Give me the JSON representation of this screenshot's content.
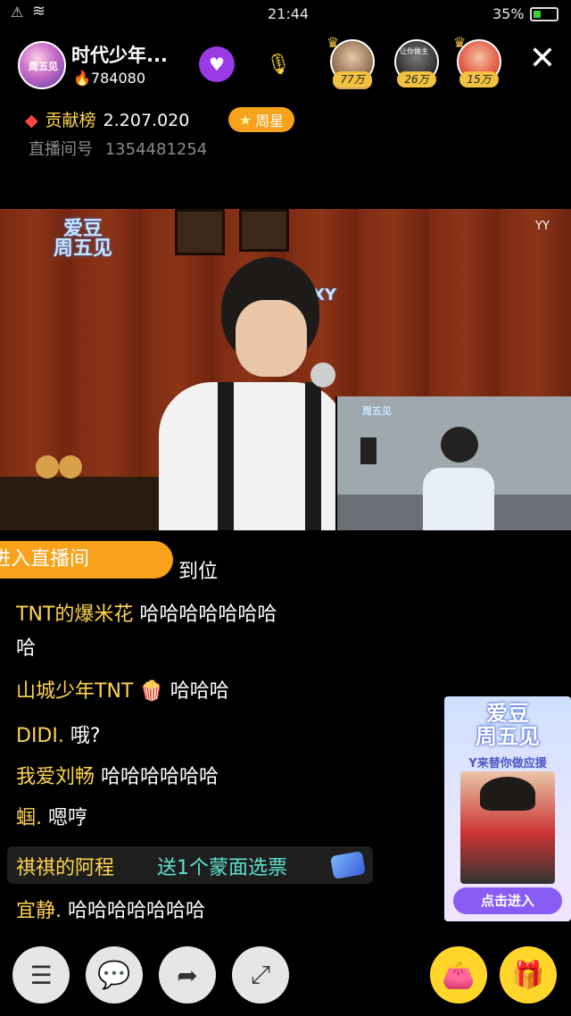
{
  "status_bar": {
    "time": "21:44",
    "battery_percent": "35%",
    "battery_level": 0.35,
    "icons": [
      "alert-icon",
      "wifi-icon",
      "battery-icon"
    ]
  },
  "header": {
    "anchor_name": "时代少年...",
    "fans_count": "784080",
    "avatar_text": "周五见",
    "rank": [
      {
        "label": "77万",
        "color": "#d9a86c"
      },
      {
        "label": "26万",
        "color": "#4a4a4a"
      },
      {
        "label": "15万",
        "color": "#e04a3a"
      }
    ],
    "rank_badge_top": "让你做主"
  },
  "contribution": {
    "label": "贡献榜",
    "value": "2.207.020",
    "star_label": "周星"
  },
  "room": {
    "label": "直播间号",
    "number": "1354481254"
  },
  "video": {
    "logo_line1": "爱豆",
    "logo_line2": "周五见",
    "brand": "YY",
    "wall_logo": "XY",
    "pip_logo": "周五见"
  },
  "chat": {
    "enter_banner": "进入直播间",
    "first_partial": "到位",
    "lines": [
      {
        "user": "TNT的爆米花",
        "msg": "哈哈哈哈哈哈哈"
      },
      {
        "user": "",
        "msg": "哈"
      },
      {
        "user": "山城少年TNT",
        "msg": "哈哈哈"
      },
      {
        "user": "DIDI.",
        "msg": "哦?"
      },
      {
        "user": "我爱刘畅",
        "msg": "哈哈哈哈哈哈"
      },
      {
        "user": "蝈.",
        "msg": "嗯哼"
      },
      {
        "user": "宜静.",
        "msg": "哈哈哈哈哈哈哈"
      }
    ],
    "gift": {
      "user": "祺祺的阿程",
      "text": "送1个蒙面选票"
    }
  },
  "promo": {
    "title_line1": "爱豆",
    "title_line2": "周五见",
    "subtitle": "Y来替你做应援",
    "button": "点击进入"
  },
  "bottom_bar": {
    "buttons": [
      "menu-icon",
      "chat-icon",
      "share-icon",
      "fullscreen-icon"
    ],
    "right_buttons": [
      "lucky-bag-icon",
      "gift-icon"
    ]
  }
}
